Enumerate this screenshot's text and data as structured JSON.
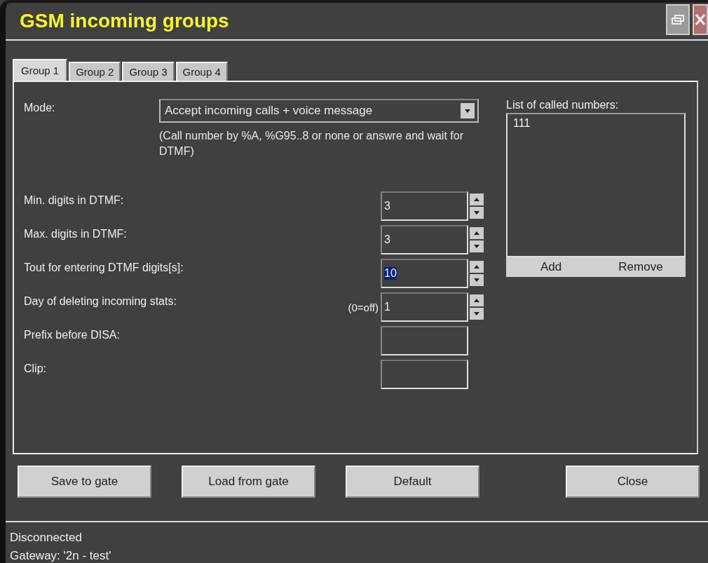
{
  "window": {
    "title": "GSM incoming groups"
  },
  "tabs": [
    {
      "label": "Group 1",
      "selected": true
    },
    {
      "label": "Group 2",
      "selected": false
    },
    {
      "label": "Group 3",
      "selected": false
    },
    {
      "label": "Group 4",
      "selected": false
    }
  ],
  "mode": {
    "label": "Mode:",
    "value": "Accept incoming calls + voice message",
    "hint": "(Call number by %A, %G95..8 or none or answre and wait for DTMF)"
  },
  "fields": [
    {
      "kind": "spin",
      "label": "Min. digits in DTMF:",
      "value": "3",
      "highlighted": false
    },
    {
      "kind": "spin",
      "label": "Max. digits in DTMF:",
      "value": "3",
      "highlighted": false
    },
    {
      "kind": "spin",
      "label": "Tout for entering DTMF digits[s]:",
      "value": "10",
      "highlighted": true
    },
    {
      "kind": "spin",
      "label": "Day of deleting incoming stats:",
      "suffix": "(0=off)",
      "value": "1",
      "highlighted": false
    },
    {
      "kind": "text",
      "label": "Prefix before DISA:"
    },
    {
      "kind": "text",
      "label": "Clip:"
    }
  ],
  "called_numbers": {
    "label": "List of called numbers:",
    "items": [
      "111"
    ],
    "buttons": [
      "Add",
      "Remove"
    ]
  },
  "buttons": [
    "Save to gate",
    "Load from gate",
    "Default",
    "Close"
  ],
  "status_bar": {
    "lines": [
      "Disconnected",
      "Gateway: '2n - test'"
    ]
  }
}
